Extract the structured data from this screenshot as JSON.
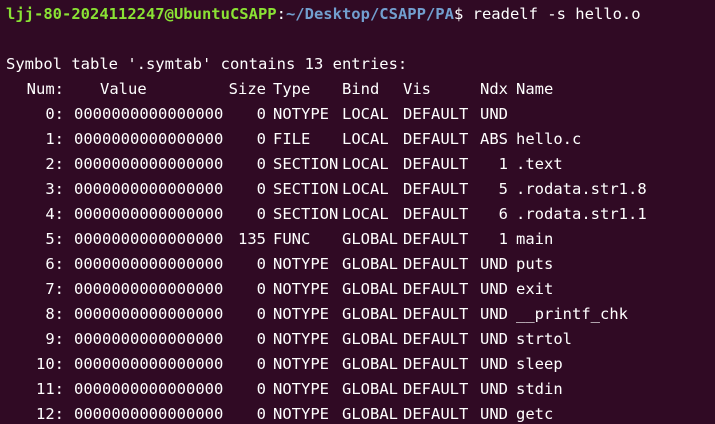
{
  "terminal": {
    "prompt": {
      "user_host": "ljj-80-2024112247@UbuntuCSAPP",
      "colon": ":",
      "path": "~/Desktop/CSAPP/PA",
      "dollar": "$",
      "command": " readelf -s hello.o"
    },
    "header_line": "Symbol table '.symtab' contains 13 entries:",
    "columns": {
      "num": "Num:",
      "value": "Value",
      "size": "Size",
      "type": "Type",
      "bind": "Bind",
      "vis": "Vis",
      "ndx": "Ndx",
      "name": "Name"
    },
    "rows": [
      {
        "num": "0:",
        "value": "0000000000000000",
        "size": "0",
        "type": "NOTYPE",
        "bind": "LOCAL",
        "vis": "DEFAULT",
        "ndx": "UND",
        "name": ""
      },
      {
        "num": "1:",
        "value": "0000000000000000",
        "size": "0",
        "type": "FILE",
        "bind": "LOCAL",
        "vis": "DEFAULT",
        "ndx": "ABS",
        "name": "hello.c"
      },
      {
        "num": "2:",
        "value": "0000000000000000",
        "size": "0",
        "type": "SECTION",
        "bind": "LOCAL",
        "vis": "DEFAULT",
        "ndx": "1",
        "name": ".text"
      },
      {
        "num": "3:",
        "value": "0000000000000000",
        "size": "0",
        "type": "SECTION",
        "bind": "LOCAL",
        "vis": "DEFAULT",
        "ndx": "5",
        "name": ".rodata.str1.8"
      },
      {
        "num": "4:",
        "value": "0000000000000000",
        "size": "0",
        "type": "SECTION",
        "bind": "LOCAL",
        "vis": "DEFAULT",
        "ndx": "6",
        "name": ".rodata.str1.1"
      },
      {
        "num": "5:",
        "value": "0000000000000000",
        "size": "135",
        "type": "FUNC",
        "bind": "GLOBAL",
        "vis": "DEFAULT",
        "ndx": "1",
        "name": "main"
      },
      {
        "num": "6:",
        "value": "0000000000000000",
        "size": "0",
        "type": "NOTYPE",
        "bind": "GLOBAL",
        "vis": "DEFAULT",
        "ndx": "UND",
        "name": "puts"
      },
      {
        "num": "7:",
        "value": "0000000000000000",
        "size": "0",
        "type": "NOTYPE",
        "bind": "GLOBAL",
        "vis": "DEFAULT",
        "ndx": "UND",
        "name": "exit"
      },
      {
        "num": "8:",
        "value": "0000000000000000",
        "size": "0",
        "type": "NOTYPE",
        "bind": "GLOBAL",
        "vis": "DEFAULT",
        "ndx": "UND",
        "name": "__printf_chk"
      },
      {
        "num": "9:",
        "value": "0000000000000000",
        "size": "0",
        "type": "NOTYPE",
        "bind": "GLOBAL",
        "vis": "DEFAULT",
        "ndx": "UND",
        "name": "strtol"
      },
      {
        "num": "10:",
        "value": "0000000000000000",
        "size": "0",
        "type": "NOTYPE",
        "bind": "GLOBAL",
        "vis": "DEFAULT",
        "ndx": "UND",
        "name": "sleep"
      },
      {
        "num": "11:",
        "value": "0000000000000000",
        "size": "0",
        "type": "NOTYPE",
        "bind": "GLOBAL",
        "vis": "DEFAULT",
        "ndx": "UND",
        "name": "stdin"
      },
      {
        "num": "12:",
        "value": "0000000000000000",
        "size": "0",
        "type": "NOTYPE",
        "bind": "GLOBAL",
        "vis": "DEFAULT",
        "ndx": "UND",
        "name": "getc"
      }
    ],
    "colors": {
      "background": "#300a24",
      "text": "#ffffff",
      "prompt_user": "#8ae234",
      "prompt_path": "#729fcf"
    }
  }
}
